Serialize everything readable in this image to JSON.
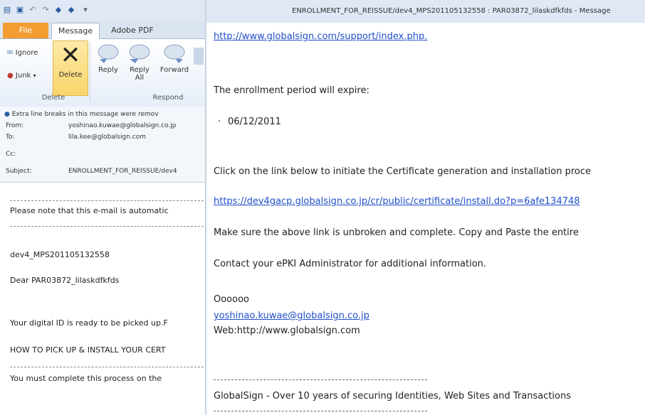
{
  "window": {
    "title": "ENROLLMENT_FOR_REISSUE/dev4_MPS201105132558 : PAR03872_lilaskdfkfds - Message"
  },
  "tabs": [
    {
      "label": "File"
    },
    {
      "label": "Message"
    },
    {
      "label": "Adobe PDF"
    }
  ],
  "ribbon": {
    "ignore_label": "Ignore",
    "junk_label": "Junk",
    "delete_label": "Delete",
    "reply_label": "Reply",
    "reply_all_label": "Reply All",
    "forward_label": "Forward",
    "group_delete": "Delete",
    "group_respond": "Respond"
  },
  "header": {
    "info": "Extra line breaks in this message were remov",
    "from_label": "From:",
    "from_value": "yoshinao.kuwae@globalsign.co.jp",
    "to_label": "To:",
    "to_value": "lila.kee@globalsign.com",
    "cc_label": "Cc:",
    "subject_label": "Subject:",
    "subject_value": "ENROLLMENT_FOR_REISSUE/dev4"
  },
  "preview": {
    "line1": "Please note that this e-mail is automatic",
    "line2": "dev4_MPS201105132558",
    "line3": "Dear PAR03872_lilaskdfkfds",
    "line4": "Your digital ID is ready to be picked up.F",
    "line5": "HOW TO PICK UP & INSTALL YOUR CERT",
    "line6": "You must complete this process on the"
  },
  "body": {
    "top_link": "http://www.globalsign.com/support/index.php.",
    "expire_text": "The enrollment period will expire:",
    "expire_date": "06/12/2011",
    "click_text": "Click on the link below to initiate the Certificate generation and installation proce",
    "install_link": "https://dev4gacp.globalsign.co.jp/cr/public/certificate/install.do?p=6afe134748",
    "make_sure": "Make sure the above link is unbroken and complete. Copy and Paste the entire",
    "contact": "Contact your ePKI Administrator for additional information.",
    "sig_name": "Oooooo",
    "sig_email": "yoshinao.kuwae@globalsign.co.jp",
    "sig_web": "Web:http://www.globalsign.com",
    "footer": "GlobalSign - Over 10 years of securing Identities, Web Sites and Transactions"
  },
  "colors": {
    "file_tab": "#f39c31",
    "link": "#1f4fc8",
    "ribbon_bg": "#e6eef8"
  }
}
